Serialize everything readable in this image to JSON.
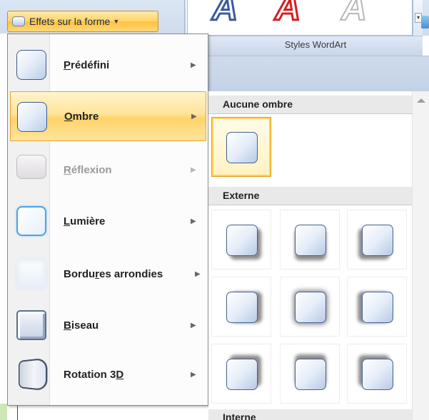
{
  "ribbon": {
    "button_label": "Effets sur la forme",
    "wordart_group_label": "Styles WordArt",
    "wordart_letter": "A",
    "accent_color": "#ffd36a"
  },
  "menu": {
    "items": [
      {
        "pre": "",
        "u": "P",
        "post": "rédéfini",
        "icon": "preset-shape-icon",
        "state": "normal"
      },
      {
        "pre": "",
        "u": "O",
        "post": "mbre",
        "icon": "shadow-shape-icon",
        "state": "active"
      },
      {
        "pre": "",
        "u": "R",
        "post": "éflexion",
        "icon": "reflection-shape-icon",
        "state": "disabled"
      },
      {
        "pre": "",
        "u": "L",
        "post": "umière",
        "icon": "glow-shape-icon",
        "state": "normal"
      },
      {
        "pre": "Bordu",
        "u": "r",
        "post": "es arrondies",
        "icon": "soft-edges-shape-icon",
        "state": "normal"
      },
      {
        "pre": "",
        "u": "B",
        "post": "iseau",
        "icon": "bevel-shape-icon",
        "state": "normal"
      },
      {
        "pre": "Rotation 3",
        "u": "D",
        "post": "",
        "icon": "rotation-3d-shape-icon",
        "state": "normal"
      }
    ],
    "arrow": "▶"
  },
  "submenu": {
    "no_shadow_header": "Aucune ombre",
    "outer_header": "Externe",
    "inner_header": "Interne"
  }
}
